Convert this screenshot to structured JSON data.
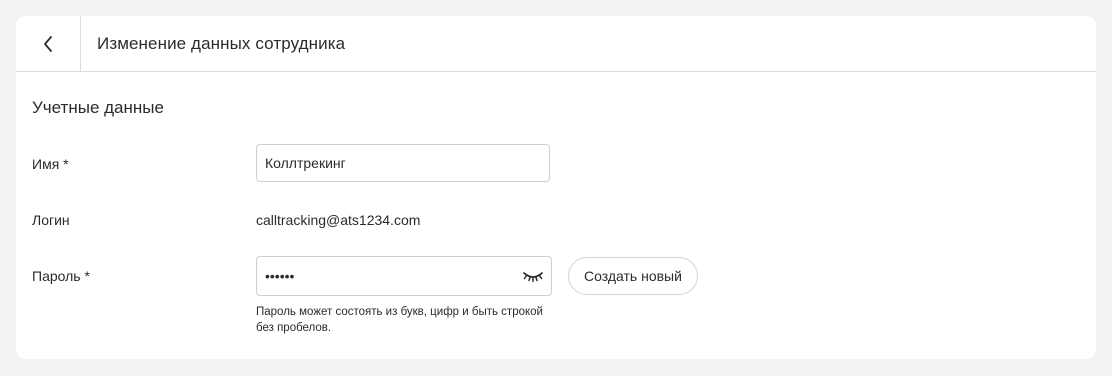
{
  "header": {
    "back_icon": "chevron-left-icon",
    "title": "Изменение данных сотрудника"
  },
  "section": {
    "title": "Учетные данные"
  },
  "form": {
    "name": {
      "label": "Имя *",
      "value": "Коллтрекинг"
    },
    "login": {
      "label": "Логин",
      "value": "calltracking@ats1234.com"
    },
    "password": {
      "label": "Пароль *",
      "value": "••••••",
      "toggle_icon": "eye-closed-icon",
      "generate_label": "Создать новый",
      "hint": "Пароль может состоять из букв, цифр и быть строкой без пробелов."
    }
  },
  "colors": {
    "background": "#f1f2f1",
    "card": "#ffffff",
    "border": "#dcdcdc",
    "text": "#2b2b2b"
  }
}
